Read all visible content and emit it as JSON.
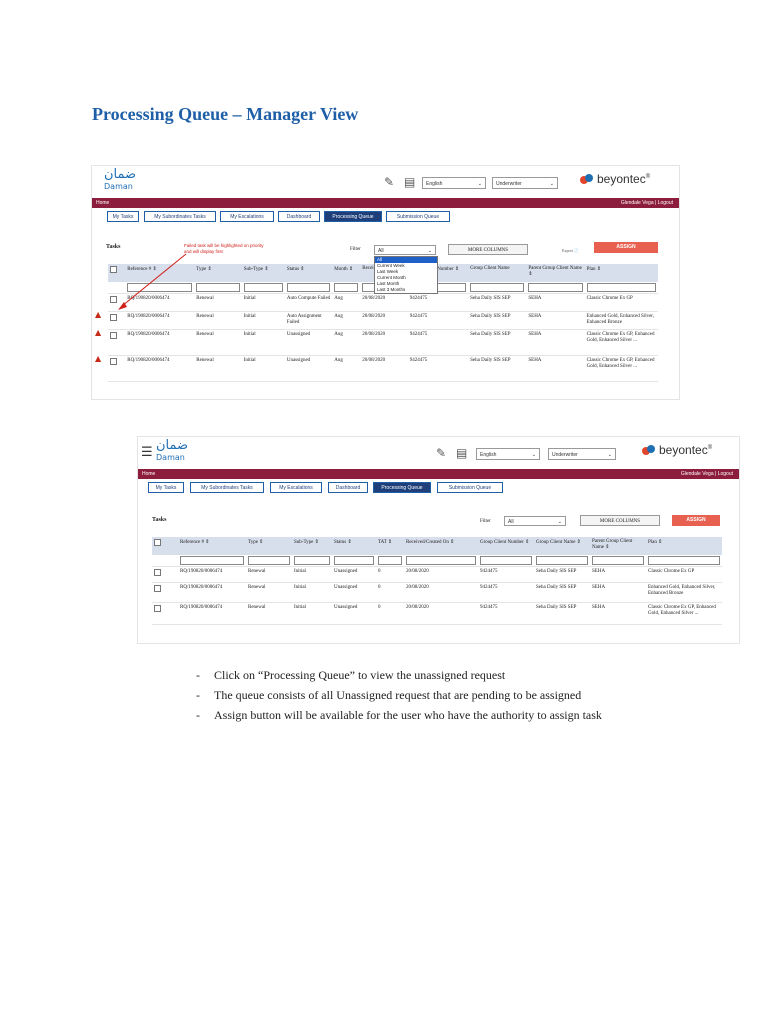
{
  "document": {
    "title": "Processing Queue – Manager View",
    "bullets": [
      "Click on “Processing Queue” to view the unassigned request",
      "The queue consists of all Unassigned request that are pending to be assigned",
      "Assign button will be available for the user who have the authority to assign task"
    ]
  },
  "app": {
    "logo_arabic": "ضمان",
    "logo_english": "Daman",
    "language_select": "English",
    "role_select": "Underwriter",
    "brand": "beyontec",
    "brand_mark": "®",
    "nav_home": "Home",
    "nav_user": "Glendale Vega | Logout",
    "tabs": [
      "My Tasks",
      "My Subordinates Tasks",
      "My Escalations",
      "Dashboard",
      "Processing Queue",
      "Submission Queue"
    ],
    "active_tab": "Processing Queue",
    "tasks_label": "Tasks",
    "filter_label": "Filter",
    "filter_value": "All",
    "more_columns": "MORE COLUMNS",
    "assign": "ASSIGN",
    "export": "Export"
  },
  "screenshot1": {
    "note": "Failed task will be highlighted on priority and will display first",
    "filter_options": [
      "All",
      "Current Week",
      "Last Week",
      "Current Month",
      "Last Month",
      "Last 3 Months"
    ],
    "columns": [
      "Reference # ⇕",
      "Type ⇕",
      "Sub-Type ⇕",
      "Status ⇕",
      "Month ⇕",
      "Received",
      "Group Client Number ⇕",
      "Group Client Name",
      "Parent Group Client Name ⇕",
      "Plan ⇕"
    ],
    "rows": [
      {
        "ref": "RQ/190820/0006474",
        "type": "Renewal",
        "subtype": "Initial",
        "status": "Auto Compute Failed",
        "month": "Aug",
        "received": "20/08/2020",
        "gcn": "9424475",
        "gname": "Seha Daily SIS SEP",
        "parent": "SEHA",
        "plan": "Classic Chrome Ex GP"
      },
      {
        "ref": "RQ/190820/0006474",
        "type": "Renewal",
        "subtype": "Initial",
        "status": "Auto Assignment Failed",
        "month": "Aug",
        "received": "20/08/2020",
        "gcn": "9424475",
        "gname": "Seha Daily SIS SEP",
        "parent": "SEHA",
        "plan": "Enhanced Gold, Enhanced Silver, Enhanced Bronze"
      },
      {
        "ref": "RQ/190820/0006474",
        "type": "Renewal",
        "subtype": "Initial",
        "status": "Unassigned",
        "month": "Aug",
        "received": "20/08/2020",
        "gcn": "9424475",
        "gname": "Seha Daily SIS SEP",
        "parent": "SEHA",
        "plan": "Classic Chrome Ex GP, Enhanced Gold, Enhanced Silver ..."
      },
      {
        "ref": "RQ/190820/0006474",
        "type": "Renewal",
        "subtype": "Initial",
        "status": "Unassigned",
        "month": "Aug",
        "received": "20/08/2020",
        "gcn": "9424475",
        "gname": "Seha Daily SIS SEP",
        "parent": "SEHA",
        "plan": "Classic Chrome Ex GP, Enhanced Gold, Enhanced Silver ..."
      }
    ]
  },
  "screenshot2": {
    "columns": [
      "Reference # ⇕",
      "Type ⇕",
      "Sub-Type ⇕",
      "Status ⇕",
      "TAT ⇕",
      "Received/Created On ⇕",
      "Group Client Number ⇕",
      "Group Client Name ⇕",
      "Parent Group Client Name ⇕",
      "Plan ⇕"
    ],
    "rows": [
      {
        "ref": "RQ/190820/0006474",
        "type": "Renewal",
        "subtype": "Initial",
        "status": "Unassigned",
        "tat": "0",
        "received": "20/08/2020",
        "gcn": "9424475",
        "gname": "Seha Daily SIS SEP",
        "parent": "SEHA",
        "plan": "Classic Chrome Ex GP"
      },
      {
        "ref": "RQ/190820/0006474",
        "type": "Renewal",
        "subtype": "Initial",
        "status": "Unassigned",
        "tat": "0",
        "received": "20/08/2020",
        "gcn": "9424475",
        "gname": "Seha Daily SIS SEP",
        "parent": "SEHA",
        "plan": "Enhanced Gold, Enhanced Silver, Enhanced Bronze"
      },
      {
        "ref": "RQ/190820/0006474",
        "type": "Renewal",
        "subtype": "Initial",
        "status": "Unassigned",
        "tat": "0",
        "received": "20/08/2020",
        "gcn": "9424475",
        "gname": "Seha Daily SIS SEP",
        "parent": "SEHA",
        "plan": "Classic Chrome Ex GP, Enhanced Gold, Enhanced Silver ..."
      }
    ]
  }
}
